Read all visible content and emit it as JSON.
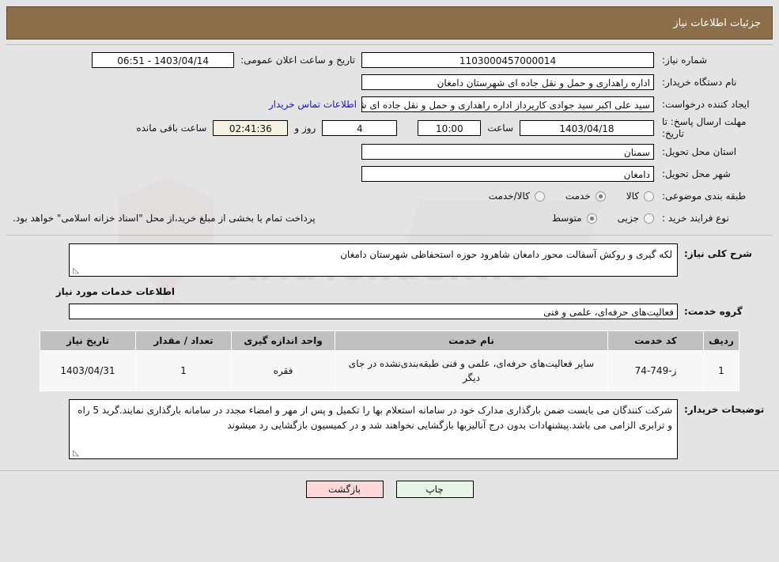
{
  "header": {
    "title": "جزئیات اطلاعات نیاز"
  },
  "watermark": {
    "text": "AriaTender.net"
  },
  "form": {
    "need_number_label": "شماره نیاز:",
    "need_number_value": "1103000457000014",
    "public_announce_label": "تاریخ و ساعت اعلان عمومی:",
    "public_announce_value": "1403/04/14 - 06:51",
    "buyer_org_label": "نام دستگاه خریدار:",
    "buyer_org_value": "اداره راهداری و حمل و نقل جاده ای شهرستان دامغان",
    "creator_label": "ایجاد کننده درخواست:",
    "creator_value": "سید علی اکبر سید جوادی کاریرداز اداره راهداری و حمل و نقل جاده ای شهرست",
    "contact_link": "اطلاعات تماس خریدار",
    "deadline_label": "مهلت ارسال پاسخ: تا تاریخ:",
    "deadline_value": "1403/04/18",
    "hour_label": "ساعت",
    "hour_value": "10:00",
    "days_value": "4",
    "days_and_label": "روز و",
    "countdown_value": "02:41:36",
    "remaining_label": "ساعت باقی مانده",
    "province_label": "استان محل تحویل:",
    "province_value": "سمنان",
    "city_label": "شهر محل تحویل:",
    "city_value": "دامغان",
    "category_label": "طبقه بندی موضوعی:",
    "category_options": [
      {
        "label": "کالا",
        "selected": false
      },
      {
        "label": "خدمت",
        "selected": true
      },
      {
        "label": "کالا/خدمت",
        "selected": false
      }
    ],
    "process_label": "نوع فرایند خرید :",
    "process_options": [
      {
        "label": "جزیی",
        "selected": false
      },
      {
        "label": "متوسط",
        "selected": true
      }
    ],
    "payment_note": "پرداخت تمام یا بخشی از مبلغ خرید،از محل \"اسناد خزانه اسلامی\" خواهد بود."
  },
  "description": {
    "need_label": "شرح کلی نیاز:",
    "need_value": "لکه گیری و روکش آسفالت محور دامغان شاهرود حوزه استحفاظی شهرستان دامغان",
    "services_section_title": "اطلاعات خدمات مورد نیاز",
    "service_group_label": "گروه خدمت:",
    "service_group_value": "فعالیت‌های حرفه‌ای، علمی و فنی"
  },
  "table": {
    "columns": [
      "ردیف",
      "کد خدمت",
      "نام خدمت",
      "واحد اندازه گیری",
      "تعداد / مقدار",
      "تاریخ نیاز"
    ],
    "rows": [
      {
        "radif": "1",
        "code": "ز-749-74",
        "name": "سایر فعالیت‌های حرفه‌ای، علمی و فنی طبقه‌بندی‌نشده در جای دیگر",
        "unit": "فقره",
        "qty": "1",
        "date": "1403/04/31"
      }
    ]
  },
  "buyer_notes": {
    "label": "توضیحات خریدار:",
    "value": "شرکت کنندگان می بایست ضمن بارگذاری مدارک خود در سامانه استعلام بها را تکمیل و پس از مهر و امضاء مجدد در سامانه بارگذاری نمایند.گرید 5 راه و ترابری الزامی می باشد.پیشنهادات بدون درج آنالیزبها بازگشایی نخواهند شد و در کمیسیون بازگشایی رد میشوند"
  },
  "footer": {
    "print_label": "چاپ",
    "back_label": "بازگشت"
  }
}
